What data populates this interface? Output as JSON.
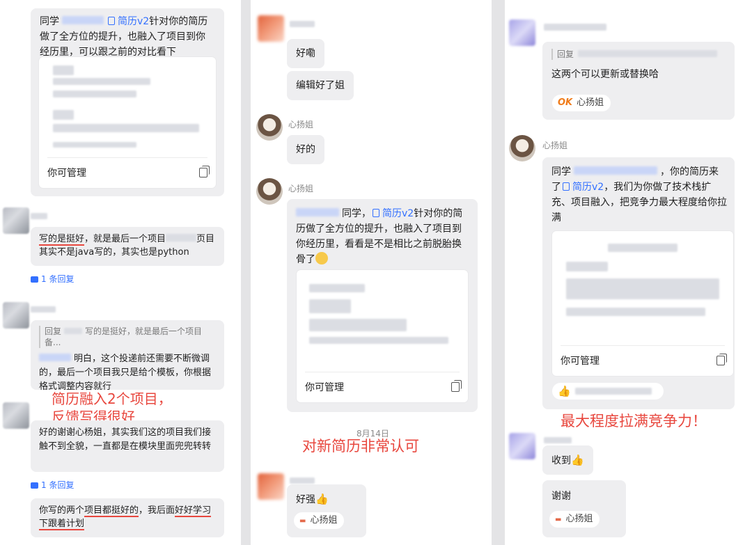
{
  "panel1": {
    "msg_top": {
      "prefix": "同学",
      "doc": "简历v2",
      "suffix": "针对你的简历做了全方位的提升，也融入了项目到你经历里，可以跟之前的对比看下"
    },
    "card_footer": "你可管理",
    "msg2": {
      "a": "写的是挺好",
      "b": "，就是最后一个项目",
      "c": "页目其实不是java写的，其实也是python"
    },
    "reply_count": "1 条回复",
    "msg3": {
      "quote_prefix": "回复",
      "quote_text": "写的是挺好，就是最后一个项目备...",
      "text": "明白，这个投递前还需要不断微调的，最后一个项目我只是给个模板，你根据格式调整内容就行"
    },
    "annotation": [
      "简历融入2个项目，",
      "反馈写得很好"
    ],
    "msg4": "好的谢谢心杨姐，其实我们这的项目我们接触不到全貌，一直都是在模块里面兜兜转转",
    "reply_count2": "1 条回复",
    "msg5": {
      "a": "你写的两个",
      "b": "项目都挺好的",
      "c": "，我后面",
      "d": "好好学",
      "e": "习下跟着计划"
    }
  },
  "panel2": {
    "bubble1": "好嘞",
    "bubble2": "编辑好了姐",
    "sender": "心扬姐",
    "bubble3": "好的",
    "sender2": "心扬姐",
    "msg": {
      "prefix": "同学，",
      "doc": "简历v2",
      "suffix": "针对你的简历做了全方位的提升，也融入了项目到你经历里，看看是不是相比之前脱胎换骨了"
    },
    "card_footer": "你可管理",
    "date": "8月14日",
    "annotation": "对新简历非常认可",
    "bubble4": "好强",
    "react_name": "心扬姐"
  },
  "panel3": {
    "quote_prefix": "回复",
    "msg1": "这两个可以更新或替换哈",
    "react_ok": "OK",
    "react_name": "心扬姐",
    "sender": "心扬姐",
    "msg2": {
      "prefix": "同学",
      "mid": "，你的简历来了",
      "doc": "简历v2",
      "suffix": "，我们为你做了技术栈扩充、项目融入，把竞争力最大程度给你拉满"
    },
    "card_footer": "你可管理",
    "annotation": "最大程度拉满竞争力！",
    "bubble3": "收到",
    "bubble4": "谢谢",
    "react_name2": "心扬姐"
  }
}
